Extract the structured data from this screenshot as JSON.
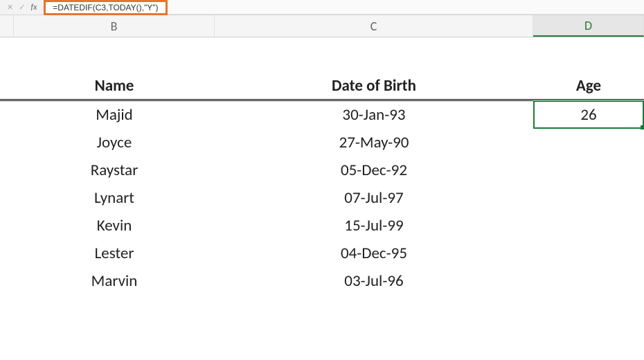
{
  "formula_bar": {
    "fx_label": "fx",
    "formula": "=DATEDIF(C3,TODAY(),\"Y\")"
  },
  "columns": {
    "B": "B",
    "C": "C",
    "D": "D"
  },
  "headers": {
    "name": "Name",
    "dob": "Date of Birth",
    "age": "Age"
  },
  "rows": [
    {
      "name": "Majid",
      "dob": "30-Jan-93",
      "age": "26"
    },
    {
      "name": "Joyce",
      "dob": "27-May-90",
      "age": ""
    },
    {
      "name": "Raystar",
      "dob": "05-Dec-92",
      "age": ""
    },
    {
      "name": "Lynart",
      "dob": "07-Jul-97",
      "age": ""
    },
    {
      "name": "Kevin",
      "dob": "15-Jul-99",
      "age": ""
    },
    {
      "name": "Lester",
      "dob": "04-Dec-95",
      "age": ""
    },
    {
      "name": "Marvin",
      "dob": "03-Jul-96",
      "age": ""
    }
  ],
  "active_cell": "D3"
}
